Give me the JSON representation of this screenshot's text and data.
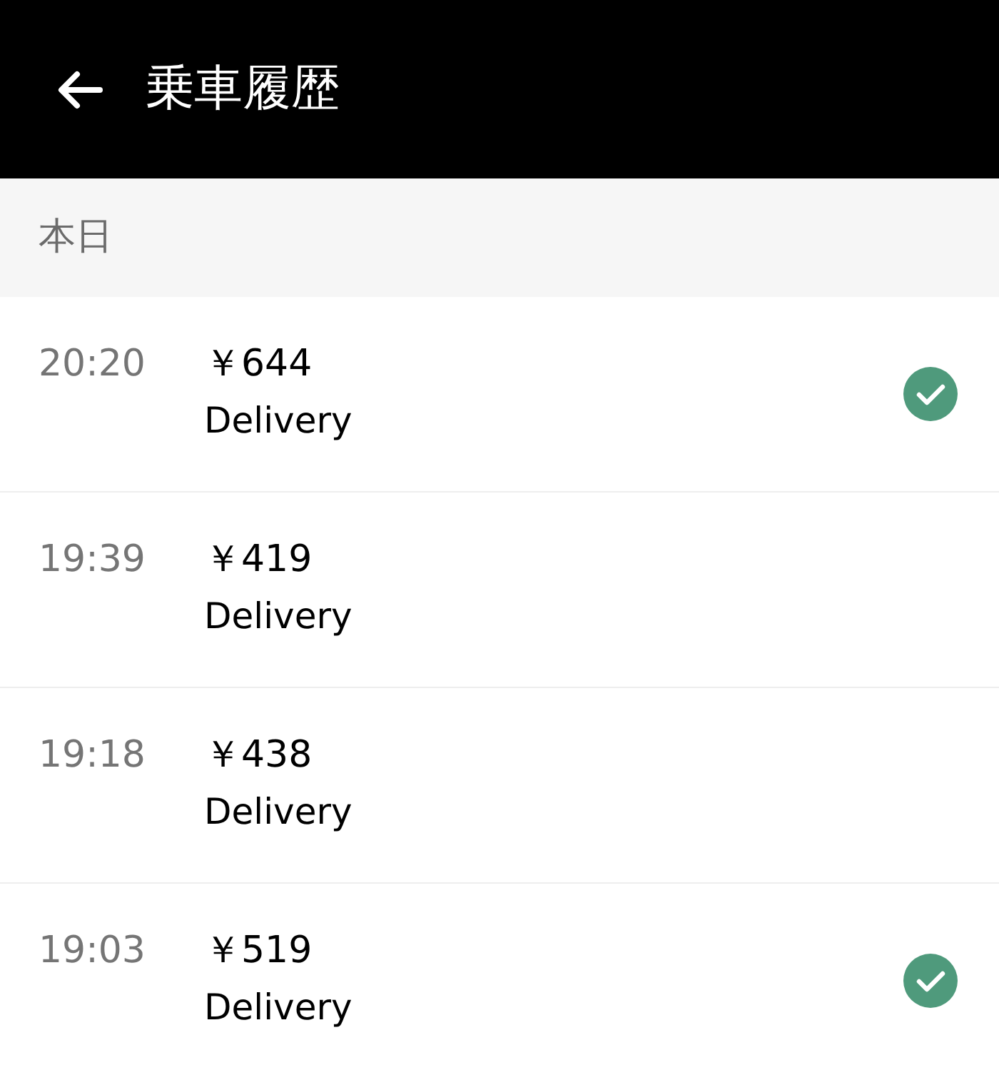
{
  "header": {
    "title": "乗車履歴"
  },
  "section": {
    "label": "本日"
  },
  "trips": [
    {
      "time": "20:20",
      "price": "￥644",
      "type": "Delivery",
      "checked": true
    },
    {
      "time": "19:39",
      "price": "￥419",
      "type": "Delivery",
      "checked": false
    },
    {
      "time": "19:18",
      "price": "￥438",
      "type": "Delivery",
      "checked": false
    },
    {
      "time": "19:03",
      "price": "￥519",
      "type": "Delivery",
      "checked": true
    }
  ]
}
